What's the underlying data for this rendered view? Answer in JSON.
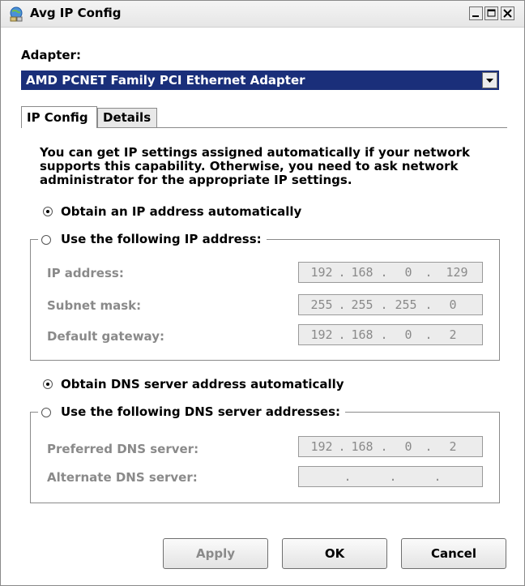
{
  "window": {
    "title": "Avg IP Config"
  },
  "adapter": {
    "label": "Adapter:",
    "selected": "AMD PCNET Family PCI Ethernet Adapter"
  },
  "tabs": [
    {
      "label": "IP Config"
    },
    {
      "label": "Details"
    }
  ],
  "description": "You can get IP settings assigned automatically if your network supports this capability. Otherwise, you need to ask network administrator for the appropriate IP settings.",
  "ip": {
    "auto_label": "Obtain an IP address automatically",
    "manual_label": "Use the following IP address:",
    "auto_selected": true,
    "fields": [
      {
        "label": "IP address:",
        "octets": [
          "192",
          "168",
          "0",
          "129"
        ]
      },
      {
        "label": "Subnet mask:",
        "octets": [
          "255",
          "255",
          "255",
          "0"
        ]
      },
      {
        "label": "Default gateway:",
        "octets": [
          "192",
          "168",
          "0",
          "2"
        ]
      }
    ]
  },
  "dns": {
    "auto_label": "Obtain DNS server address automatically",
    "manual_label": "Use the following DNS server addresses:",
    "auto_selected": true,
    "fields": [
      {
        "label": "Preferred DNS server:",
        "octets": [
          "192",
          "168",
          "0",
          "2"
        ]
      },
      {
        "label": "Alternate DNS server:",
        "octets": [
          "",
          "",
          "",
          ""
        ]
      }
    ]
  },
  "buttons": {
    "apply": "Apply",
    "ok": "OK",
    "cancel": "Cancel"
  }
}
